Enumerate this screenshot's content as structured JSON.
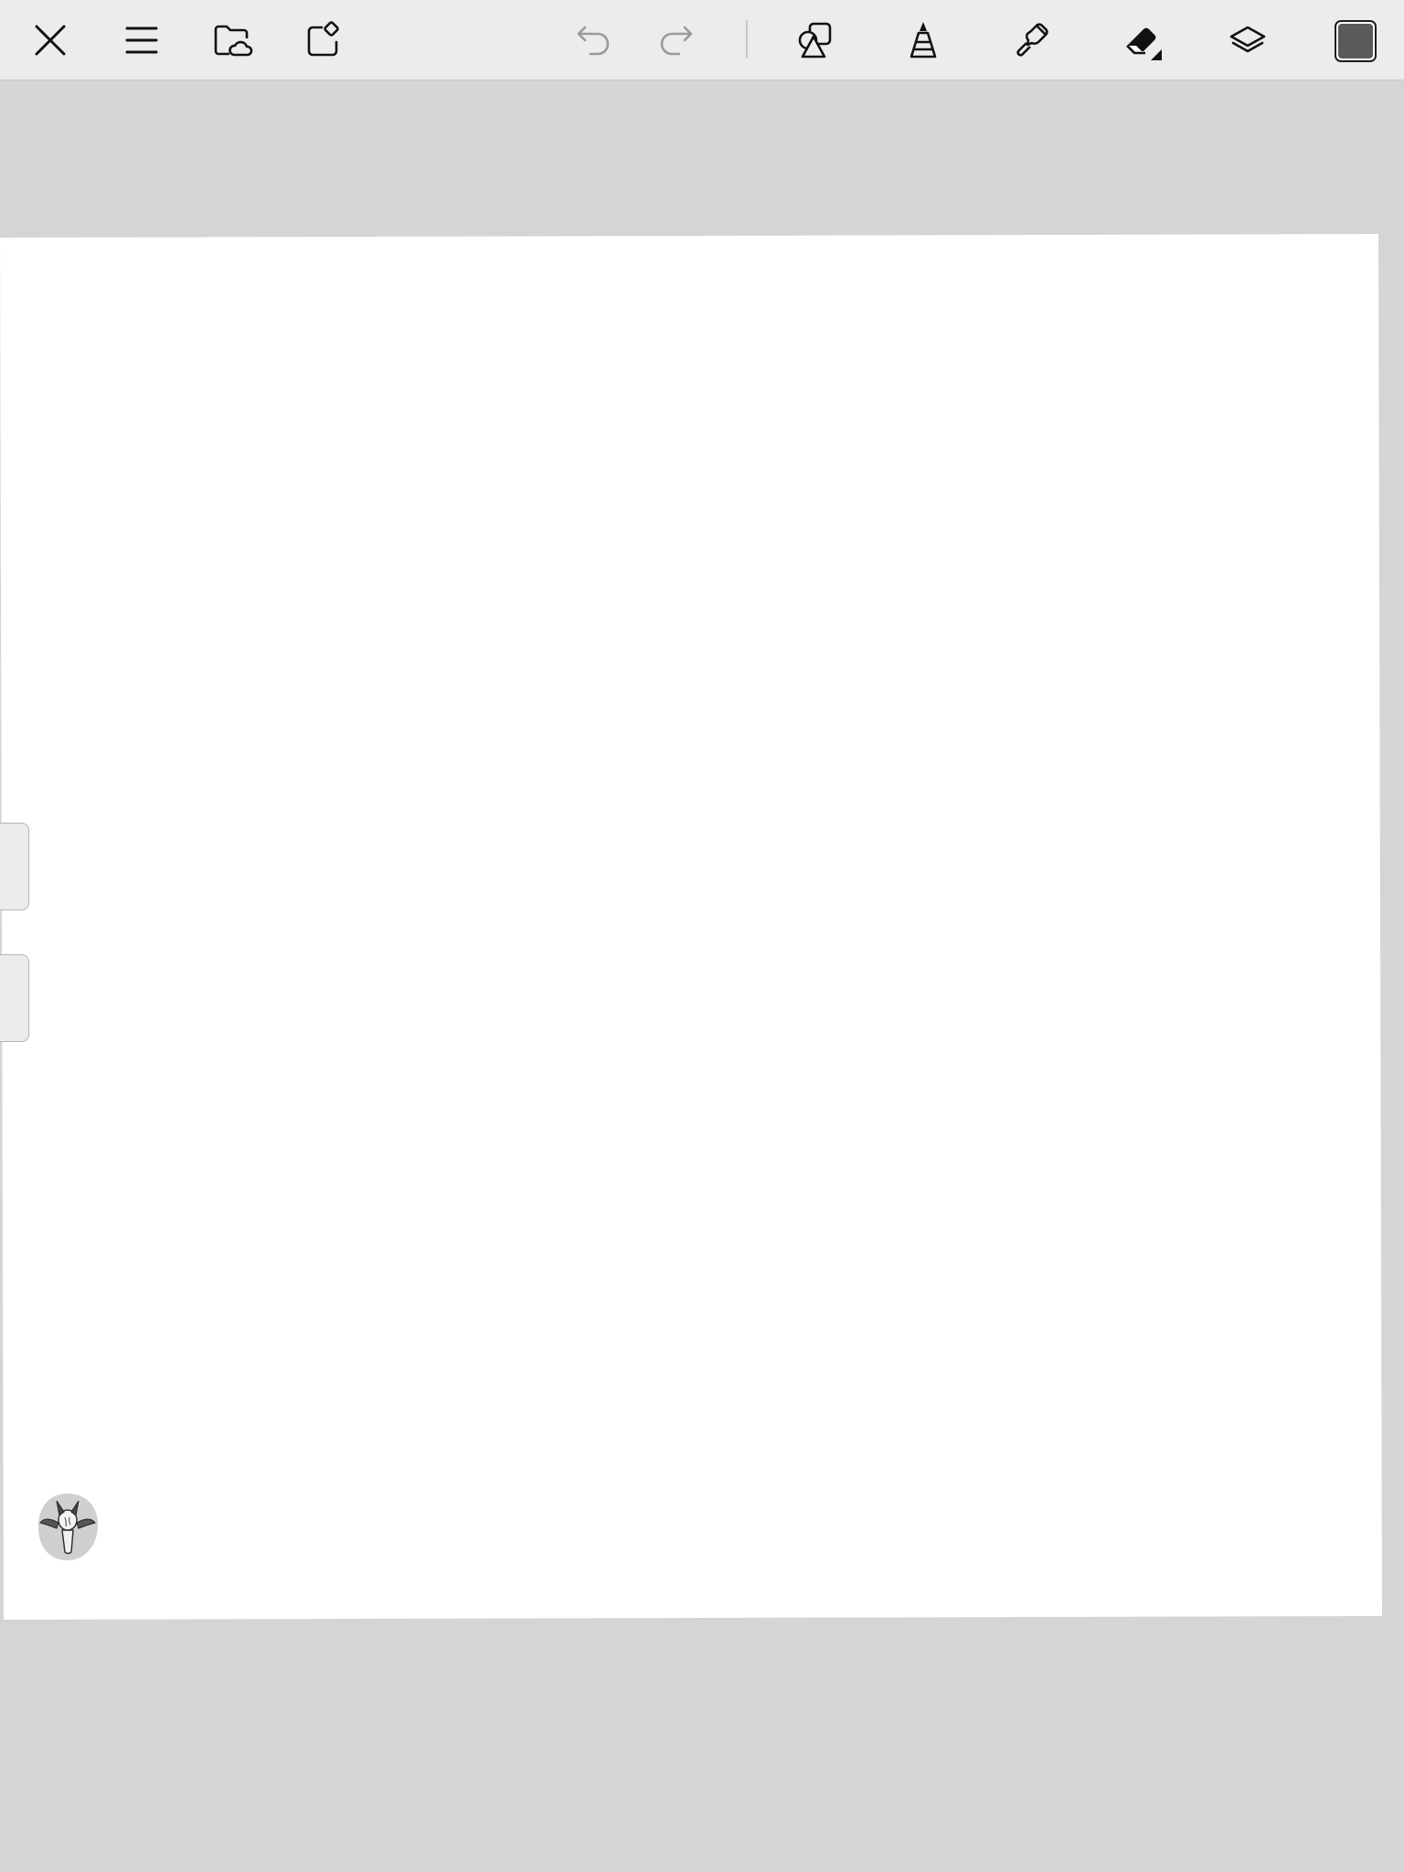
{
  "toolbar": {
    "left_tools": [
      {
        "icon": "close-icon"
      },
      {
        "icon": "menu-icon"
      },
      {
        "icon": "cloud-folder-icon"
      },
      {
        "icon": "new-canvas-icon"
      }
    ],
    "history": [
      {
        "icon": "undo-icon",
        "enabled": false
      },
      {
        "icon": "redo-icon",
        "enabled": false
      }
    ],
    "tools": [
      {
        "icon": "shapes-icon"
      },
      {
        "icon": "brush-icon"
      },
      {
        "icon": "smudge-icon"
      },
      {
        "icon": "eraser-icon",
        "selected": true
      },
      {
        "icon": "layers-icon"
      }
    ],
    "current_color": "#5a5a5a"
  },
  "canvas": {
    "background": "#ffffff"
  },
  "side_handles": [
    {
      "icon": "brush-size-slider"
    },
    {
      "icon": "opacity-slider"
    }
  ],
  "avatar": {
    "icon": "user-avatar"
  }
}
